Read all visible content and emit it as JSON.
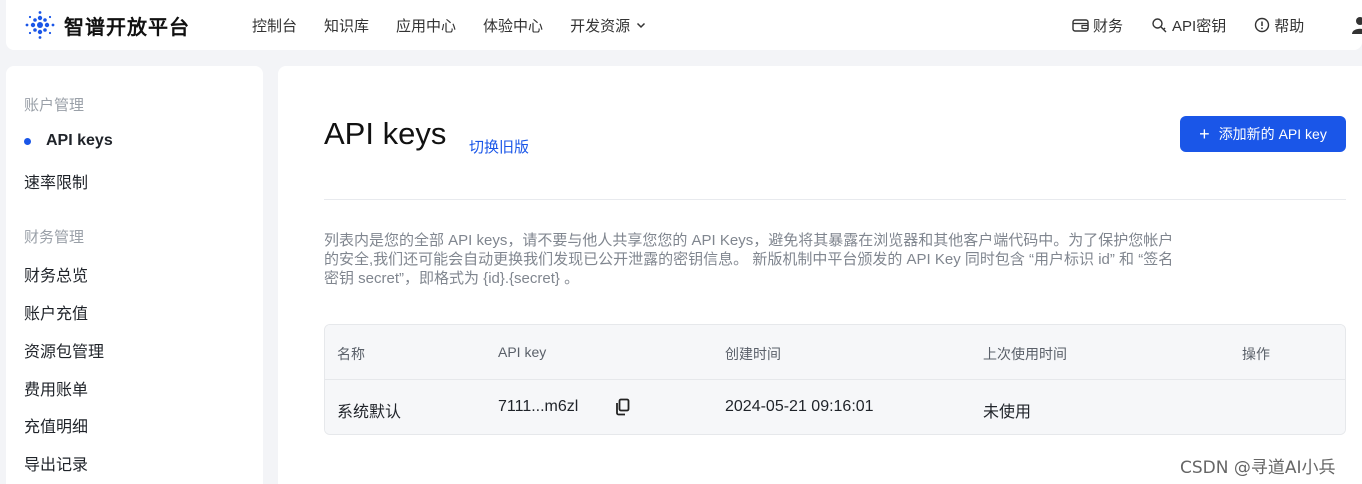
{
  "header": {
    "logo_text": "智谱开放平台",
    "nav": [
      {
        "label": "控制台"
      },
      {
        "label": "知识库"
      },
      {
        "label": "应用中心"
      },
      {
        "label": "体验中心"
      },
      {
        "label": "开发资源"
      }
    ],
    "right_nav": [
      {
        "label": "财务",
        "icon": "wallet-icon"
      },
      {
        "label": "API密钥",
        "icon": "key-icon"
      },
      {
        "label": "帮助",
        "icon": "help-icon"
      }
    ]
  },
  "sidebar": {
    "groups": [
      {
        "title": "账户管理",
        "items": [
          {
            "label": "API keys",
            "active": true
          },
          {
            "label": "速率限制"
          }
        ]
      },
      {
        "title": "财务管理",
        "items": [
          {
            "label": "财务总览"
          },
          {
            "label": "账户充值"
          },
          {
            "label": "资源包管理"
          },
          {
            "label": "费用账单"
          },
          {
            "label": "充值明细"
          },
          {
            "label": "导出记录"
          }
        ]
      }
    ]
  },
  "main": {
    "title": "API keys",
    "switch_link": "切换旧版",
    "add_button": "添加新的 API key",
    "description": "列表内是您的全部 API keys，请不要与他人共享您您的 API Keys，避免将其暴露在浏览器和其他客户端代码中。为了保护您帐户的安全,我们还可能会自动更换我们发现已公开泄露的密钥信息。 新版机制中平台颁发的 API Key 同时包含 “用户标识 id” 和 “签名密钥 secret”，即格式为 {id}.{secret} 。",
    "table": {
      "columns": [
        "名称",
        "API key",
        "创建时间",
        "上次使用时间",
        "操作"
      ],
      "rows": [
        {
          "name": "系统默认",
          "api_key": "7111...m6zl",
          "created": "2024-05-21 09:16:01",
          "last_used": "未使用"
        }
      ]
    }
  },
  "watermark": "CSDN @寻道AI小兵",
  "colors": {
    "accent": "#1a56e8",
    "background": "#f3f4f7"
  }
}
